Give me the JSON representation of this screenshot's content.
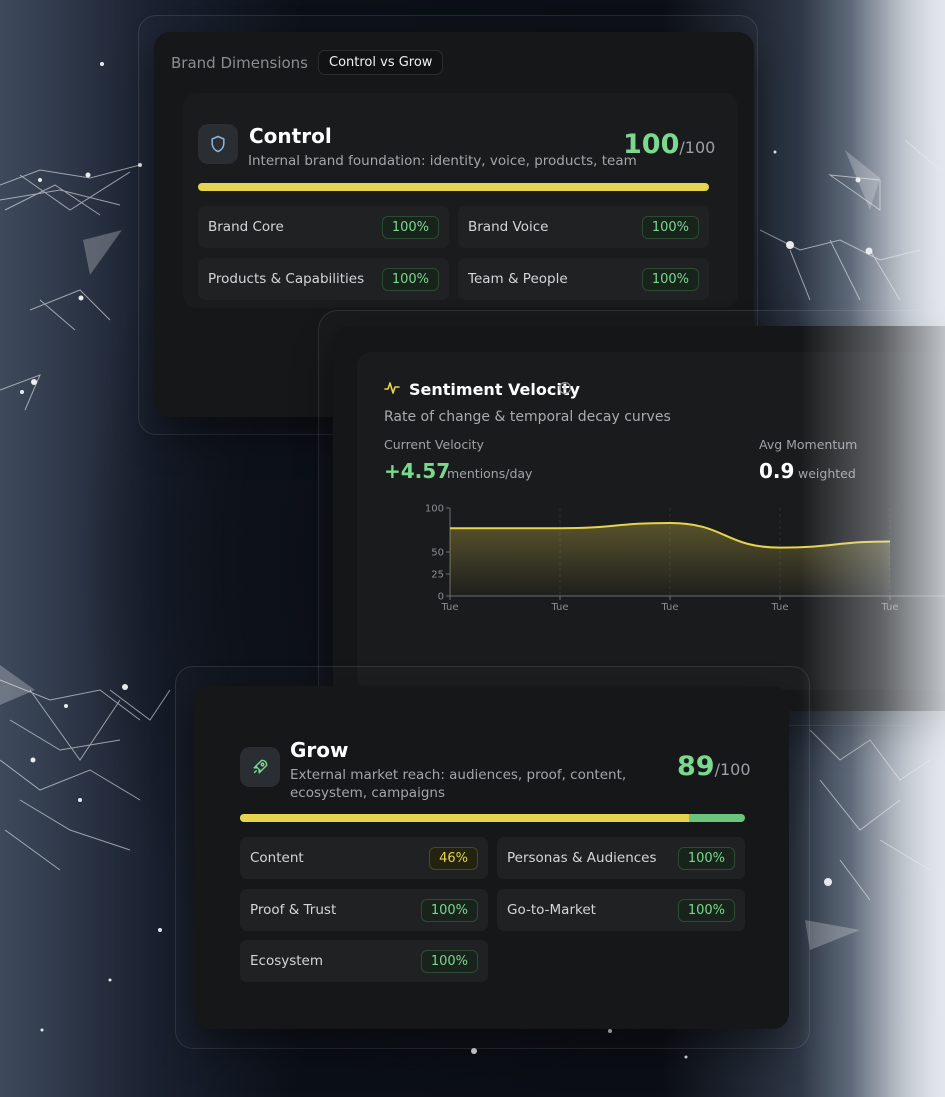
{
  "header": {
    "title": "Brand Dimensions",
    "toggle_label": "Control vs Grow"
  },
  "control": {
    "icon": "shield-icon",
    "title": "Control",
    "subtitle": "Internal brand foundation: identity, voice, products, team",
    "score": "100",
    "score_max": "/100",
    "progress": 1.0,
    "tiles": [
      {
        "label": "Brand Core",
        "value": "100%"
      },
      {
        "label": "Brand Voice",
        "value": "100%"
      },
      {
        "label": "Products & Capabilities",
        "value": "100%"
      },
      {
        "label": "Team & People",
        "value": "100%"
      }
    ]
  },
  "sentiment": {
    "icon": "activity-icon",
    "info_icon": "info-icon",
    "title": "Sentiment Velocity",
    "subtitle": "Rate of change & temporal decay curves",
    "current_label": "Current Velocity",
    "current_value": "+4.57",
    "current_unit": "mentions/day",
    "momentum_label": "Avg Momentum",
    "momentum_value": "0.9",
    "momentum_unit": "weighted"
  },
  "chart_data": {
    "type": "area",
    "y_ticks": [
      "100",
      "50",
      "25",
      "0"
    ],
    "ylim": [
      0,
      100
    ],
    "x_ticks": [
      "Tue",
      "Tue",
      "Tue",
      "Tue",
      "Tue"
    ],
    "x": [
      0,
      1,
      2,
      3,
      4
    ],
    "values": [
      77,
      77,
      83,
      55,
      62
    ],
    "color": "#e6d34e",
    "grid": true
  },
  "grow": {
    "icon": "rocket-icon",
    "title": "Grow",
    "subtitle": "External market reach: audiences, proof, content, ecosystem, campaigns",
    "score": "89",
    "score_max": "/100",
    "progress": 0.89,
    "tiles": [
      {
        "label": "Content",
        "value": "46%"
      },
      {
        "label": "Personas & Audiences",
        "value": "100%"
      },
      {
        "label": "Proof & Trust",
        "value": "100%"
      },
      {
        "label": "Go-to-Market",
        "value": "100%"
      },
      {
        "label": "Ecosystem",
        "value": "100%"
      }
    ]
  },
  "colors": {
    "accent_green": "#7bd88f",
    "accent_yellow": "#e6d34e",
    "background": "#0b0e15"
  }
}
